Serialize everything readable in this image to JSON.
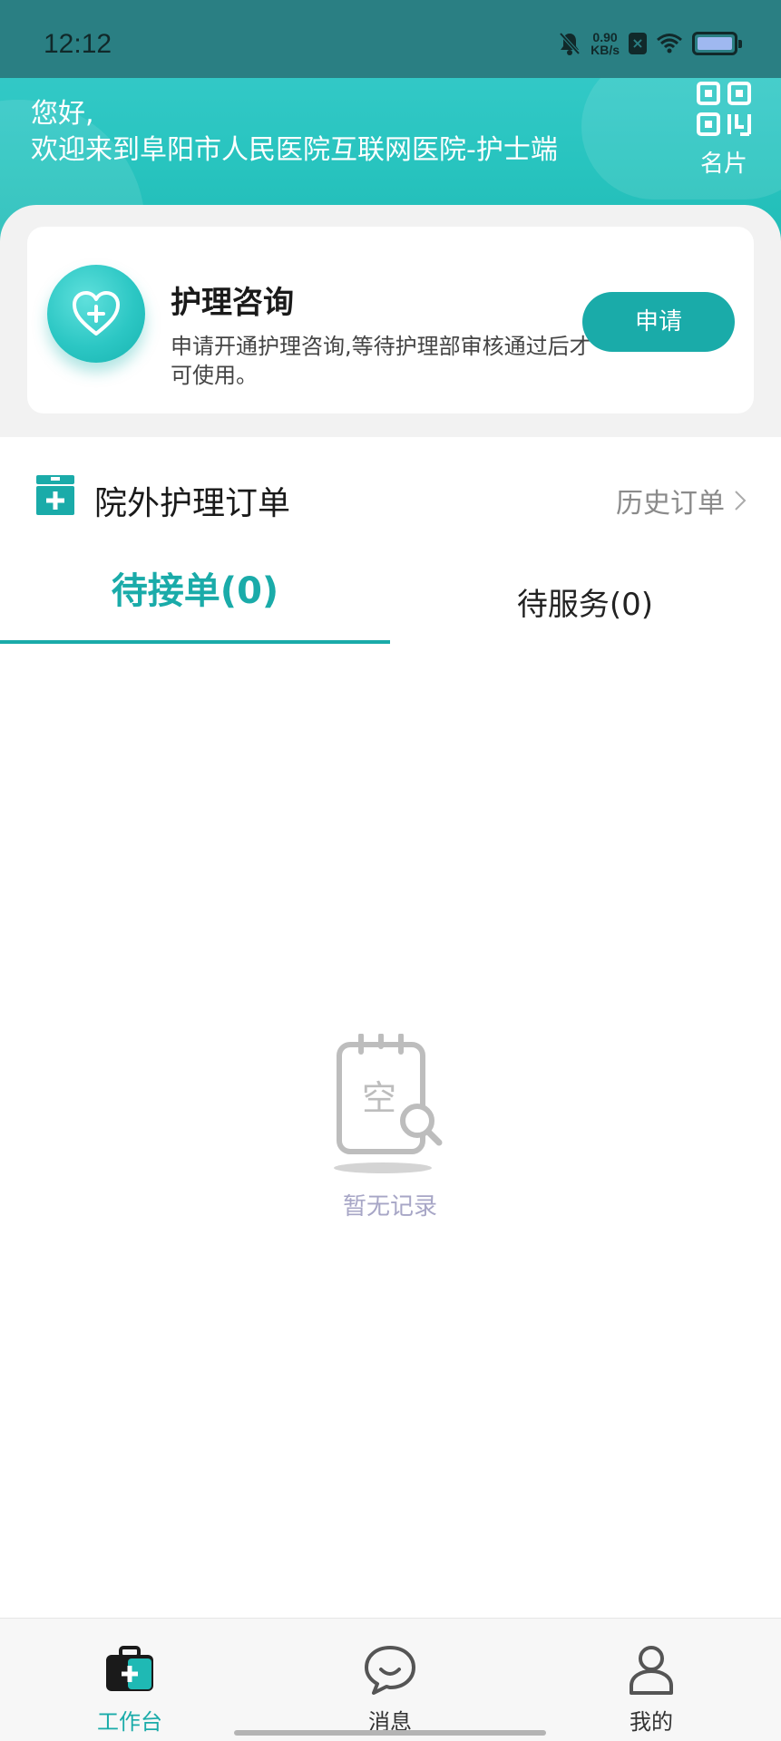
{
  "status_bar": {
    "time": "12:12",
    "net_speed_value": "0.90",
    "net_speed_unit": "KB/s",
    "icons": [
      "bell-mute-icon",
      "x-badge-icon",
      "wifi-icon",
      "battery-icon"
    ]
  },
  "header": {
    "greeting": "您好,",
    "welcome": "欢迎来到阜阳市人民医院互联网医院-护士端",
    "card_label": "名片",
    "card_icon": "qr-code-icon"
  },
  "consult": {
    "title": "护理咨询",
    "description": "申请开通护理咨询,等待护理部审核通过后才可使用。",
    "apply_label": "申请",
    "icon": "heart-plus-icon"
  },
  "orders": {
    "title": "院外护理订单",
    "history_label": "历史订单",
    "tabs": [
      {
        "label": "待接单(0)",
        "active": true
      },
      {
        "label": "待服务(0)",
        "active": false
      }
    ],
    "empty_text": "暂无记录"
  },
  "bottom_nav": {
    "items": [
      {
        "label": "工作台",
        "icon": "medical-kit-icon",
        "active": true
      },
      {
        "label": "消息",
        "icon": "chat-bubble-icon",
        "active": false
      },
      {
        "label": "我的",
        "icon": "person-icon",
        "active": false
      }
    ]
  },
  "colors": {
    "accent": "#1aaba9",
    "header_gradient_top": "#2a8a8f",
    "header_gradient_bottom": "#1fb9b4",
    "empty_text": "#a7a6c6"
  }
}
